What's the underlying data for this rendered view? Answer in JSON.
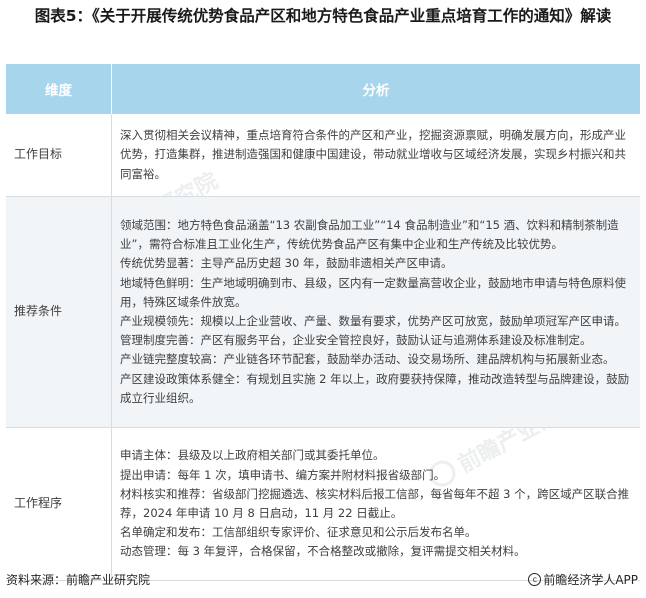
{
  "title": "图表5：《关于开展传统优势食品产区和地方特色食品产业重点培育工作的通知》解读",
  "table": {
    "headers": [
      "维度",
      "分析"
    ],
    "rows": [
      {
        "dimension": "工作目标",
        "lines": [
          "深入贯彻相关会议精神，重点培育符合条件的产区和产业，挖掘资源禀赋，明确发展方向，形成产业优势，打造集群，推进制造强国和健康中国建设，带动就业增收与区域经济发展，实现乡村振兴和共同富裕。"
        ]
      },
      {
        "dimension": "推荐条件",
        "lines": [
          "领域范围：地方特色食品涵盖“13 农副食品加工业”“14 食品制造业”和“15 酒、饮料和精制茶制造业”，需符合标准且工业化生产，传统优势食品产区有集中企业和生产传统及比较优势。",
          "传统优势显著：主导产品历史超 30 年，鼓励非遗相关产区申请。",
          "地域特色鲜明：生产地域明确到市、县级，区内有一定数量高营收企业，鼓励地市申请与特色原料使用，特殊区域条件放宽。",
          "产业规模领先：规模以上企业营收、产量、数量有要求，优势产区可放宽，鼓励单项冠军产区申请。",
          "管理制度完善：产区有服务平台，企业安全管控良好，鼓励认证与追溯体系建设及标准制定。",
          "产业链完整度较高：产业链各环节配套，鼓励举办活动、设交易场所、建品牌机构与拓展新业态。",
          "产区建设政策体系健全：有规划且实施 2 年以上，政府要获持保障，推动改造转型与品牌建设，鼓励成立行业组织。"
        ]
      },
      {
        "dimension": "工作程序",
        "lines": [
          "申请主体：县级及以上政府相关部门或其委托单位。",
          "提出申请：每年 1 次，填申请书、编方案并附材料报省级部门。",
          "材料核实和推荐：省级部门挖掘遴选、核实材料后报工信部，每省每年不超 3 个，跨区域产区联合推荐，2024 年申请 10 月 8 日启动，11 月 22 日截止。",
          "名单确定和发布：工信部组织专家评价、征求意见和公示后发布名单。",
          "动态管理：每 3 年复评，合格保留，不合格整改或撤除，复评需提交相关材料。"
        ]
      }
    ]
  },
  "footer": {
    "source": "资料来源：前瞻产业研究院",
    "copyright_symbol": "c",
    "brand": "前瞻经济学人APP"
  },
  "watermark": {
    "text": "前瞻产业研究院"
  },
  "colors": {
    "header_bg": "#a7d5ec",
    "alt_row_bg": "#f1f5f8",
    "border": "#d6dde3",
    "text": "#404040"
  }
}
